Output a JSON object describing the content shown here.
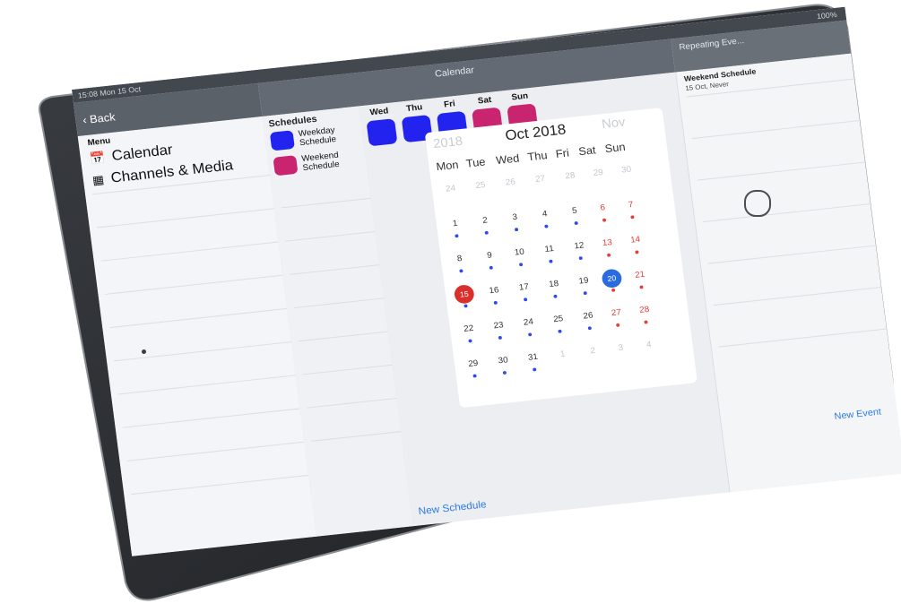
{
  "status": {
    "time": "15:08  Mon 15 Oct",
    "battery": "100%"
  },
  "nav": {
    "back_label": "Back",
    "calendar_title": "Calendar",
    "repeating_title": "Repeating Eve..."
  },
  "menu": {
    "heading": "Menu",
    "items": [
      {
        "label": "Calendar",
        "icon": "calendar-icon"
      },
      {
        "label": "Channels & Media",
        "icon": "film-icon"
      }
    ]
  },
  "schedules": {
    "heading": "Schedules",
    "items": [
      {
        "label": "Weekday Schedule",
        "color": "#2323f0"
      },
      {
        "label": "Weekend Schedule",
        "color": "#c8246f"
      }
    ]
  },
  "week_days": [
    {
      "label": "Wed",
      "color": "#2323f0"
    },
    {
      "label": "Thu",
      "color": "#2323f0"
    },
    {
      "label": "Fri",
      "color": "#2323f0"
    },
    {
      "label": "Sat",
      "color": "#c8246f"
    },
    {
      "label": "Sun",
      "color": "#c8246f"
    }
  ],
  "calendar": {
    "prev_year": "2018",
    "month": "Oct 2018",
    "next_month": "Nov",
    "weekdays": [
      "Mon",
      "Tue",
      "Wed",
      "Thu",
      "Fri",
      "Sat",
      "Sun"
    ],
    "today": "15",
    "selected": "20"
  },
  "repeating": {
    "item_title": "Weekend Schedule",
    "item_sub": "15 Oct, Never"
  },
  "actions": {
    "new_schedule": "New Schedule",
    "new_event": "New Event"
  },
  "colors": {
    "weekday": "#2323f0",
    "weekend": "#c8246f",
    "today": "#d9302b",
    "selected": "#2b6be0",
    "link": "#2c7be5"
  }
}
